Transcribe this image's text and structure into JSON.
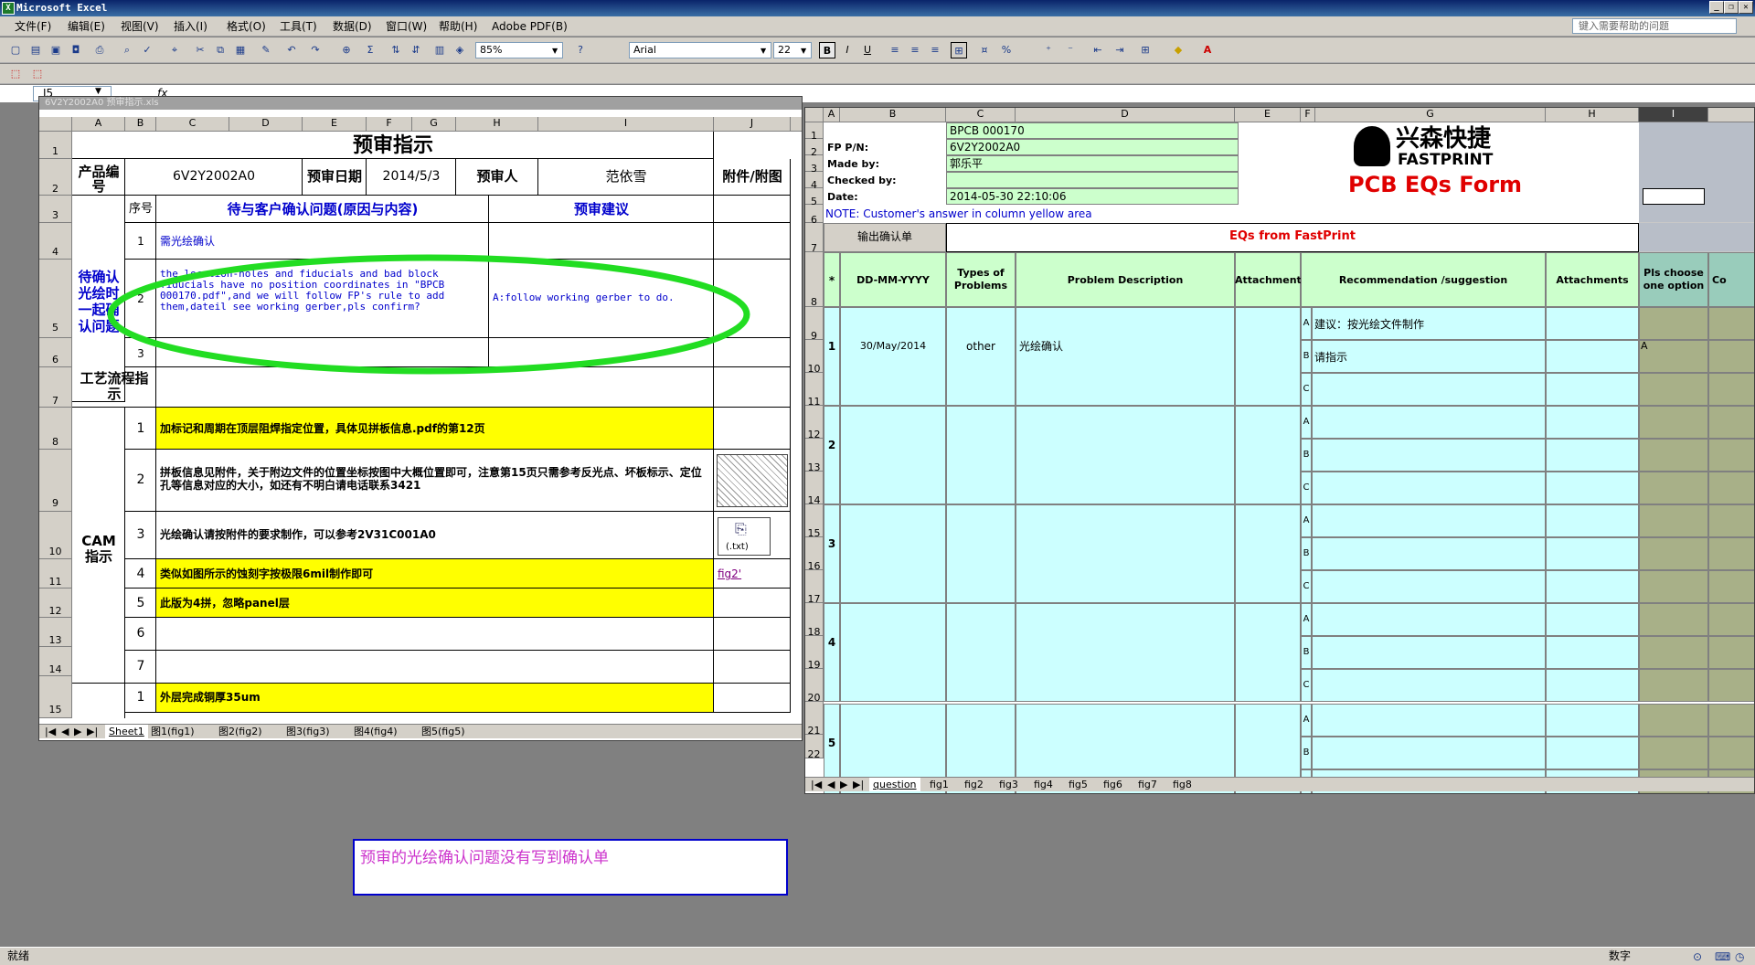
{
  "app": {
    "title": "Microsoft Excel",
    "help_placeholder": "键入需要帮助的问题",
    "status_left": "就绪",
    "status_right": "数字"
  },
  "menu": [
    "文件(F)",
    "编辑(E)",
    "视图(V)",
    "插入(I)",
    "格式(O)",
    "工具(T)",
    "数据(D)",
    "窗口(W)",
    "帮助(H)",
    "Adobe PDF(B)"
  ],
  "toolbar": {
    "zoom": "85%",
    "font": "Arial",
    "font_size": "22",
    "bold": "B",
    "italic": "I",
    "underline": "U",
    "sigma": "Σ",
    "percent": "%"
  },
  "formula": {
    "name_box": "I5",
    "fx": "fx"
  },
  "left_window": {
    "title": "6V2Y2002A0 预审指示.xls",
    "cols": [
      "A",
      "B",
      "C",
      "D",
      "E",
      "F",
      "G",
      "H",
      "I",
      "J",
      "K"
    ],
    "rows": [
      "1",
      "2",
      "3",
      "4",
      "5",
      "6",
      "7",
      "8",
      "9",
      "10",
      "11",
      "12",
      "13",
      "14",
      "15"
    ],
    "sheet_title": "预审指示",
    "label_product": "产品编号",
    "product_no": "6V2Y2002A0",
    "label_date": "预审日期",
    "date": "2014/5/3",
    "label_reviewer": "预审人",
    "reviewer": "范依雪",
    "label_attach": "附件/附图",
    "label_seq": "序号",
    "label_issues": "待与客户确认问题(原因与内容)",
    "label_suggest": "预审建议",
    "section_confirm": "待确认光绘时一起确认问题",
    "issue1": "需光绘确认",
    "issue2": "the location-holes and fiducials and bad block fiducials have no position coordinates in \"BPCB 000170.pdf\",and we will follow FP's rule to add them,dateil see working gerber,pls confirm?",
    "suggest2": "A:follow working gerber to do.",
    "n1": "1",
    "n2": "2",
    "n3": "3",
    "n4": "4",
    "n5": "5",
    "n6": "6",
    "n7": "7",
    "section_flow": "工艺流程指示",
    "section_cam": "CAM指示",
    "cam1": "加标记和周期在顶层阻焊指定位置，具体见拼板信息.pdf的第12页",
    "cam2": "拼板信息见附件，关于附边文件的位置坐标按图中大概位置即可，注意第15页只需参考反光点、坏板标示、定位孔等信息对应的大小，如还有不明白请电话联系3421",
    "cam3": "光绘确认请按附件的要求制作，可以参考2V31C001A0",
    "cam4": "类似如图所示的蚀刻字按极限6mil制作即可",
    "cam5": "此版为4拼，忽略panel层",
    "outer1": "外层完成铜厚35um",
    "attach_txt": "(.txt)",
    "fig_link": "fig2'",
    "tabs": [
      "Sheet1",
      "图1(fig1)",
      "图2(fig2)",
      "图3(fig3)",
      "图4(fig4)",
      "图5(fig5)"
    ]
  },
  "right_window": {
    "cols": [
      "A",
      "B",
      "C",
      "D",
      "E",
      "F",
      "G",
      "H",
      "I"
    ],
    "rows": [
      "1",
      "2",
      "3",
      "4",
      "5",
      "6",
      "7",
      "8",
      "9",
      "10",
      "11",
      "12",
      "13",
      "14",
      "15",
      "16",
      "17",
      "18",
      "19",
      "20",
      "21",
      "22"
    ],
    "customer_pn": "BPCB 000170",
    "label_fp": "FP P/N:",
    "fp_pn": "6V2Y2002A0",
    "label_made": "Made by:",
    "made_by": "郭乐平",
    "label_checked": "Checked by:",
    "label_date": "Date:",
    "date": "2014-05-30 22:10:06",
    "note": "NOTE: Customer's  answer in column yellow area",
    "logo_cn": "兴森快捷",
    "logo_en": "FASTPRINT",
    "form_title": "PCB EQs Form",
    "export_button": "输出确认单",
    "eq_header": "EQs from FastPrint",
    "h_star": "*",
    "h_date": "DD-MM-YYYY",
    "h_types": "Types of Problems",
    "h_desc": "Problem Description",
    "h_attach": "Attachment",
    "h_rec": "Recommendation /suggestion",
    "h_attachs": "Attachments",
    "h_choose": "Pls choose one option",
    "h_co": "Co",
    "eq1_no": "1",
    "eq1_date": "30/May/2014",
    "eq1_type": "other",
    "eq1_desc": "光绘确认",
    "eq1_a": "建议：按光绘文件制作",
    "eq1_b": "请指示",
    "eq1_choice": "A",
    "opt_a": "A",
    "opt_b": "B",
    "opt_c": "C",
    "eq2_no": "2",
    "eq3_no": "3",
    "eq4_no": "4",
    "eq5_no": "5",
    "tabs": [
      "question",
      "fig1",
      "fig2",
      "fig3",
      "fig4",
      "fig5",
      "fig6",
      "fig7",
      "fig8"
    ]
  },
  "annotation": {
    "text": "预审的光绘确认问题没有写到确认单",
    "color": "#cc33cc",
    "border": "#0000cc",
    "ellipse_color": "#22dd22"
  }
}
